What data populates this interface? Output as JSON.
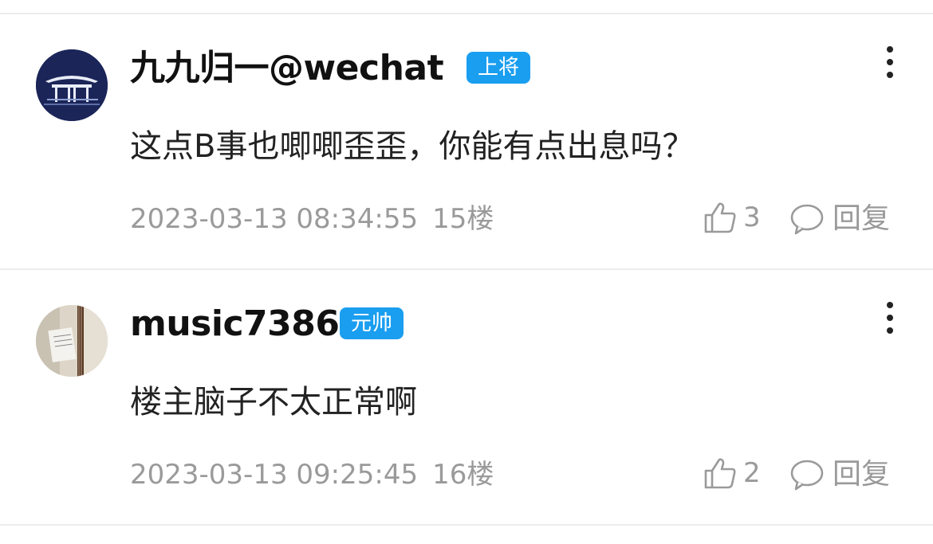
{
  "colors": {
    "badge_blue": "#1a9ef0",
    "meta_gray": "#9a9a9a",
    "text_dark": "#111111"
  },
  "comments": [
    {
      "username": "九九归一@wechat",
      "rank_badge": "上将",
      "avatar": "pavilion-avatar",
      "content": "这点B事也唧唧歪歪，你能有点出息吗？",
      "timestamp": "2023-03-13 08:34:55",
      "floor": "15楼",
      "like_count": "3",
      "reply_label": "回复",
      "more_icon": "more-vertical-icon"
    },
    {
      "username": "music7386",
      "rank_badge": "元帅",
      "avatar": "guitar-avatar",
      "content": "楼主脑子不太正常啊",
      "timestamp": "2023-03-13 09:25:45",
      "floor": "16楼",
      "like_count": "2",
      "reply_label": "回复",
      "more_icon": "more-vertical-icon"
    }
  ]
}
